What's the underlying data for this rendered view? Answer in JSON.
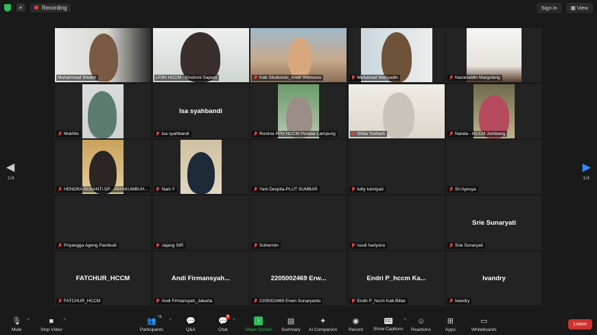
{
  "topbar": {
    "recording_label": "Recording",
    "sign_in_label": "Sign in",
    "view_label": "View"
  },
  "pagination": {
    "left": "1/4",
    "right": "1/4"
  },
  "tiles": [
    {
      "label": "Muhammad Sholeh",
      "big": "",
      "video": "sholeh",
      "muted": false
    },
    {
      "label": "LP3H HCCM - Khoironi Saparti",
      "big": "",
      "video": "khoironi",
      "muted": false,
      "active": true
    },
    {
      "label": "Kab Situbondo_Andri Wibisono",
      "big": "",
      "video": "andri",
      "muted": true
    },
    {
      "label": "Muhamad Wahyudin",
      "big": "",
      "video": "wahyudin",
      "muted": true
    },
    {
      "label": "Nazaruddin Margolang",
      "big": "",
      "video": "nazar",
      "muted": true
    },
    {
      "label": "Mukhlis",
      "big": "",
      "video": "mukhlis",
      "muted": true
    },
    {
      "label": "Isa syahbandi",
      "big": "Isa syahbandi",
      "video": "",
      "muted": true
    },
    {
      "label": "Roslina PPH HCCM Pesibar Lampung",
      "big": "",
      "video": "roslina",
      "muted": true
    },
    {
      "label": "Ghita Yosharti",
      "big": "",
      "video": "ghita",
      "muted": true
    },
    {
      "label": "Nanda - HCCM Jombang",
      "big": "",
      "video": "nanda",
      "muted": true
    },
    {
      "label": "HENDRA SUSANTI.SP - PAYAKUMBUH...",
      "big": "",
      "video": "hendra",
      "muted": true
    },
    {
      "label": "Nani Y",
      "big": "",
      "video": "nani",
      "muted": true
    },
    {
      "label": "Yani Despita-PLUT SUMBAR",
      "big": "",
      "video": "",
      "muted": true
    },
    {
      "label": "tutty tutmiyati",
      "big": "",
      "video": "",
      "muted": true
    },
    {
      "label": "Sri Ayesya",
      "big": "",
      "video": "",
      "muted": true
    },
    {
      "label": "Priyangga Ageng Pambudi",
      "big": "",
      "video": "",
      "muted": true
    },
    {
      "label": "Jajang SIR",
      "big": "",
      "video": "",
      "muted": true
    },
    {
      "label": "Suhermin",
      "big": "",
      "video": "",
      "muted": true
    },
    {
      "label": "rusdi hariyono",
      "big": "",
      "video": "",
      "muted": true
    },
    {
      "label": "Srie Sunaryati",
      "big": "Srie Sunaryati",
      "video": "",
      "muted": true
    },
    {
      "label": "FATCHUR_HCCM",
      "big": "FATCHUR_HCCM",
      "video": "",
      "muted": true
    },
    {
      "label": "Andi Firmansyah_Jakarta",
      "big": "Andi  Firmansyah...",
      "video": "",
      "muted": true
    },
    {
      "label": "2205002469 Erwin Sunaryanto",
      "big": "2205002469 Erw...",
      "video": "",
      "muted": true
    },
    {
      "label": "Endri P_hccm Kab.Blitar",
      "big": "Endri P_hccm Ka...",
      "video": "",
      "muted": true
    },
    {
      "label": "Ivandry",
      "big": "Ivandry",
      "video": "",
      "muted": true
    }
  ],
  "toolbar": {
    "mute": "Mute",
    "stop_video": "Stop Video",
    "participants": "Participants",
    "participants_count": "78",
    "qa": "Q&A",
    "chat": "Chat",
    "chat_badge": "4",
    "share_screen": "Share Screen",
    "summary": "Summary",
    "ai_companion": "AI Companion",
    "record": "Record",
    "show_captions": "Show Captions",
    "reactions": "Reactions",
    "apps": "Apps",
    "whiteboards": "Whiteboards",
    "leave": "Leave"
  },
  "colors": {
    "accent_blue": "#2d8cff",
    "active_speaker": "#d4e26a",
    "leave_red": "#d0312d",
    "share_green": "#2ebd59"
  }
}
